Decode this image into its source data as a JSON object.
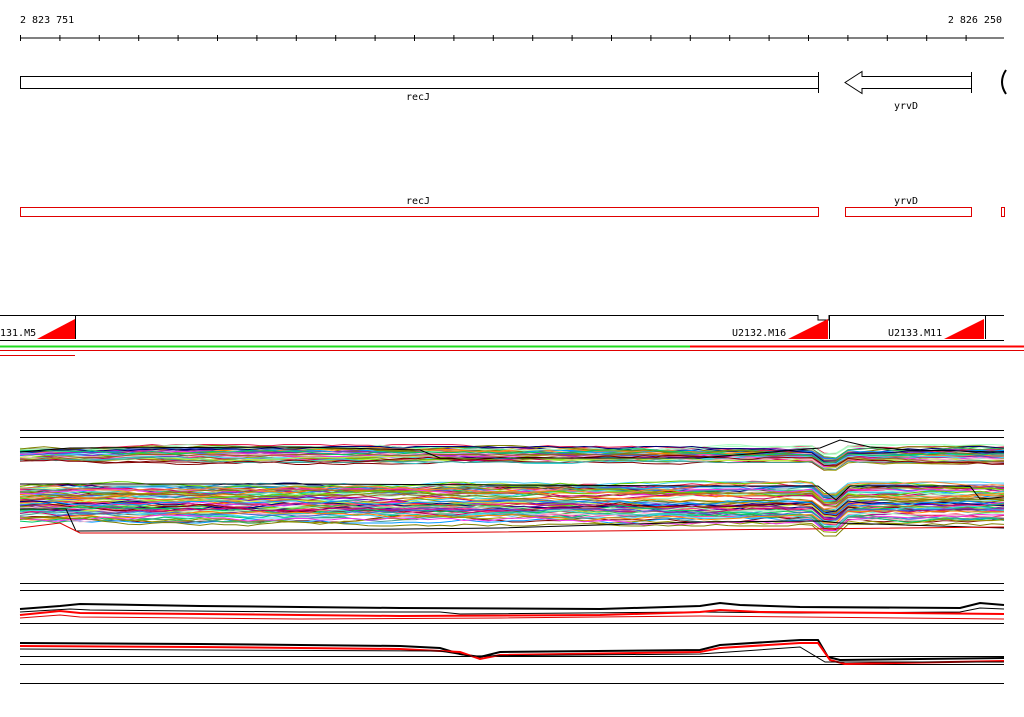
{
  "ruler": {
    "start_label": "2 823 751",
    "end_label": "2 826 250"
  },
  "colors": {
    "black": "#000000",
    "red": "#ff0000",
    "dark_red": "#e00000",
    "green": "#22dd22"
  },
  "genes_track": {
    "genes": [
      {
        "name": "recJ",
        "strand": "+"
      },
      {
        "name": "yrvD",
        "strand": "-"
      }
    ]
  },
  "annotation_track": {
    "genes": [
      {
        "name": "recJ"
      },
      {
        "name": "yrvD"
      }
    ]
  },
  "segment_track": {
    "segments": [
      {
        "label": "131.M5"
      },
      {
        "label": "U2132.M16"
      },
      {
        "label": "U2133.M11"
      }
    ]
  },
  "expression_panel_1": {
    "palette": [
      "#e6194b",
      "#3cb44b",
      "#4363d8",
      "#f58231",
      "#911eb4",
      "#42d4f4",
      "#f032e6",
      "#bfef45",
      "#fabed4",
      "#469990",
      "#9A6324",
      "#800000",
      "#aaffc3",
      "#808000",
      "#000075",
      "#00cc66",
      "#ff8800",
      "#6600cc",
      "#0099ff",
      "#cc0066",
      "#66cc00",
      "#ff3399",
      "#33cccc",
      "#999900"
    ]
  }
}
